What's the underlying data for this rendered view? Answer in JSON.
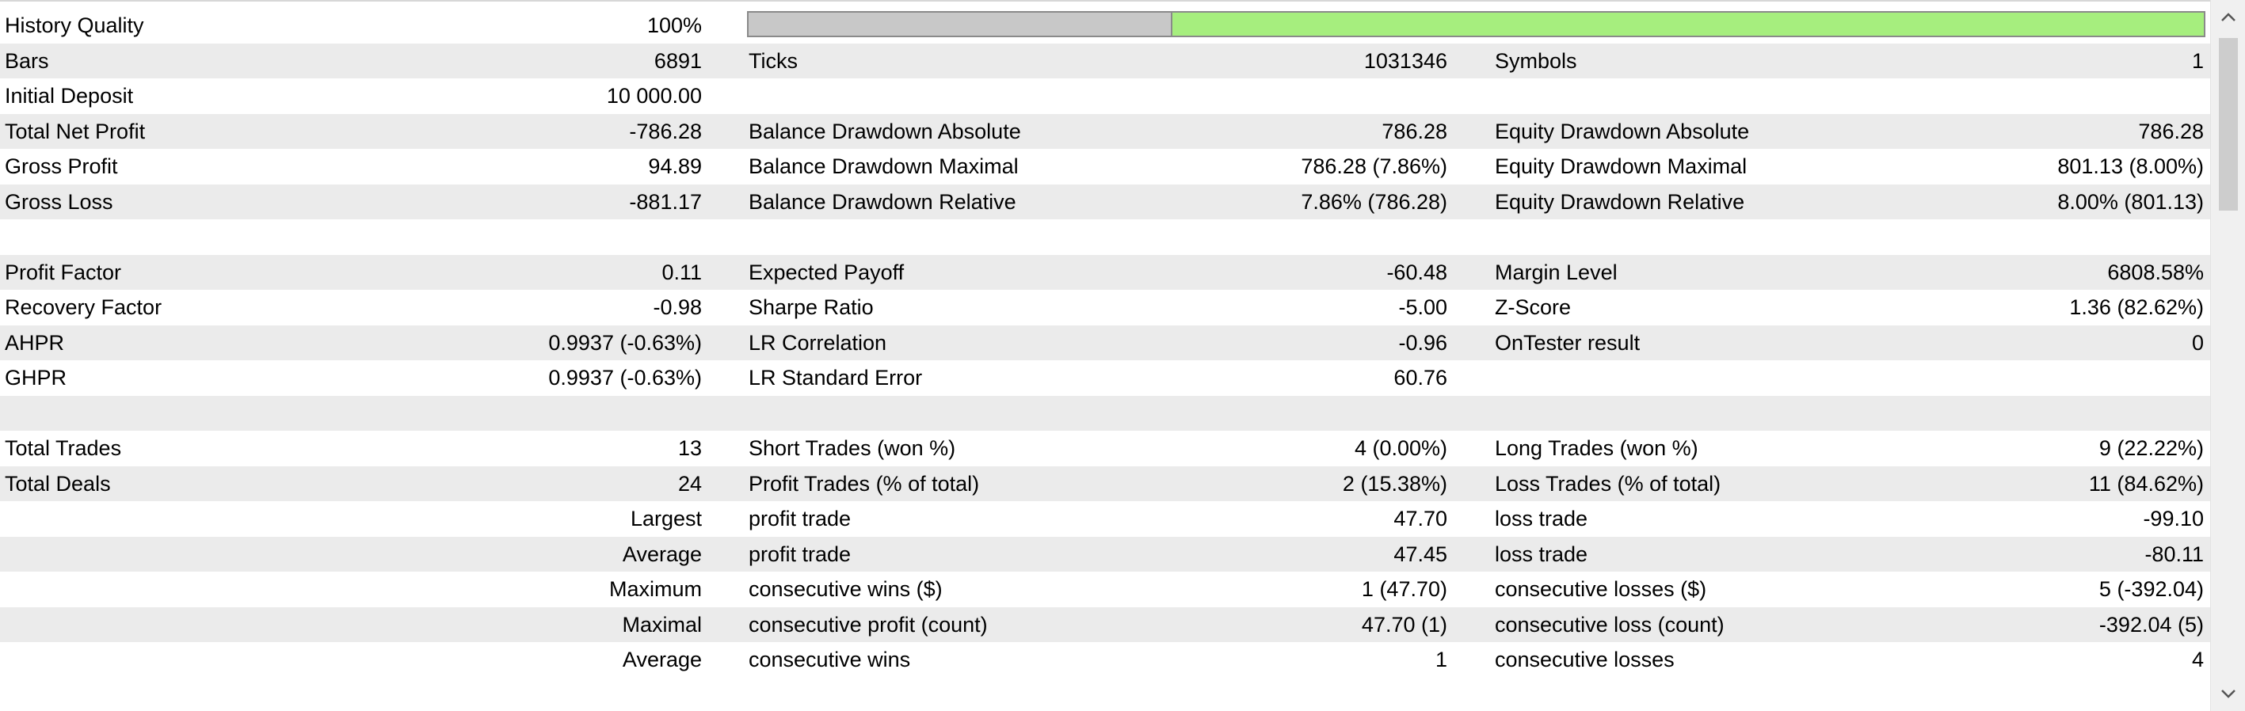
{
  "report": {
    "history_quality": {
      "label": "History Quality",
      "value": "100%",
      "progress_percent": 100
    },
    "rows": [
      {
        "l1": "Bars",
        "v1": "6891",
        "l2": "Ticks",
        "v2": "1031346",
        "l3": "Symbols",
        "v3": "1"
      },
      {
        "l1": "Initial Deposit",
        "v1": "10 000.00",
        "l2": "",
        "v2": "",
        "l3": "",
        "v3": ""
      },
      {
        "l1": "Total Net Profit",
        "v1": "-786.28",
        "l2": "Balance Drawdown Absolute",
        "v2": "786.28",
        "l3": "Equity Drawdown Absolute",
        "v3": "786.28"
      },
      {
        "l1": "Gross Profit",
        "v1": "94.89",
        "l2": "Balance Drawdown Maximal",
        "v2": "786.28 (7.86%)",
        "l3": "Equity Drawdown Maximal",
        "v3": "801.13 (8.00%)"
      },
      {
        "l1": "Gross Loss",
        "v1": "-881.17",
        "l2": "Balance Drawdown Relative",
        "v2": "7.86% (786.28)",
        "l3": "Equity Drawdown Relative",
        "v3": "8.00% (801.13)"
      },
      {
        "l1": "",
        "v1": "",
        "l2": "",
        "v2": "",
        "l3": "",
        "v3": ""
      },
      {
        "l1": "Profit Factor",
        "v1": "0.11",
        "l2": "Expected Payoff",
        "v2": "-60.48",
        "l3": "Margin Level",
        "v3": "6808.58%"
      },
      {
        "l1": "Recovery Factor",
        "v1": "-0.98",
        "l2": "Sharpe Ratio",
        "v2": "-5.00",
        "l3": "Z-Score",
        "v3": "1.36 (82.62%)"
      },
      {
        "l1": "AHPR",
        "v1": "0.9937 (-0.63%)",
        "l2": "LR Correlation",
        "v2": "-0.96",
        "l3": "OnTester result",
        "v3": "0"
      },
      {
        "l1": "GHPR",
        "v1": "0.9937 (-0.63%)",
        "l2": "LR Standard Error",
        "v2": "60.76",
        "l3": "",
        "v3": ""
      },
      {
        "l1": "",
        "v1": "",
        "l2": "",
        "v2": "",
        "l3": "",
        "v3": ""
      },
      {
        "l1": "Total Trades",
        "v1": "13",
        "l2": "Short Trades (won %)",
        "v2": "4 (0.00%)",
        "l3": "Long Trades (won %)",
        "v3": "9 (22.22%)"
      },
      {
        "l1": "Total Deals",
        "v1": "24",
        "l2": "Profit Trades (% of total)",
        "v2": "2 (15.38%)",
        "l3": "Loss Trades (% of total)",
        "v3": "11 (84.62%)"
      },
      {
        "l1": "",
        "r1": "Largest",
        "l2": "profit trade",
        "v2": "47.70",
        "l3": "loss trade",
        "v3": "-99.10"
      },
      {
        "l1": "",
        "r1": "Average",
        "l2": "profit trade",
        "v2": "47.45",
        "l3": "loss trade",
        "v3": "-80.11"
      },
      {
        "l1": "",
        "r1": "Maximum",
        "l2": "consecutive wins ($)",
        "v2": "1 (47.70)",
        "l3": "consecutive losses ($)",
        "v3": "5 (-392.04)"
      },
      {
        "l1": "",
        "r1": "Maximal",
        "l2": "consecutive profit (count)",
        "v2": "47.70 (1)",
        "l3": "consecutive loss (count)",
        "v3": "-392.04 (5)"
      },
      {
        "l1": "",
        "r1": "Average",
        "l2": "consecutive wins",
        "v2": "1",
        "l3": "consecutive losses",
        "v3": "4"
      }
    ]
  },
  "scrollbar": {
    "up_icon": "chevron-up-icon",
    "down_icon": "chevron-down-icon"
  },
  "colors": {
    "progress_fill": "#a6ee7e",
    "progress_track": "#c8c8c8",
    "row_shade": "#ebebeb"
  }
}
